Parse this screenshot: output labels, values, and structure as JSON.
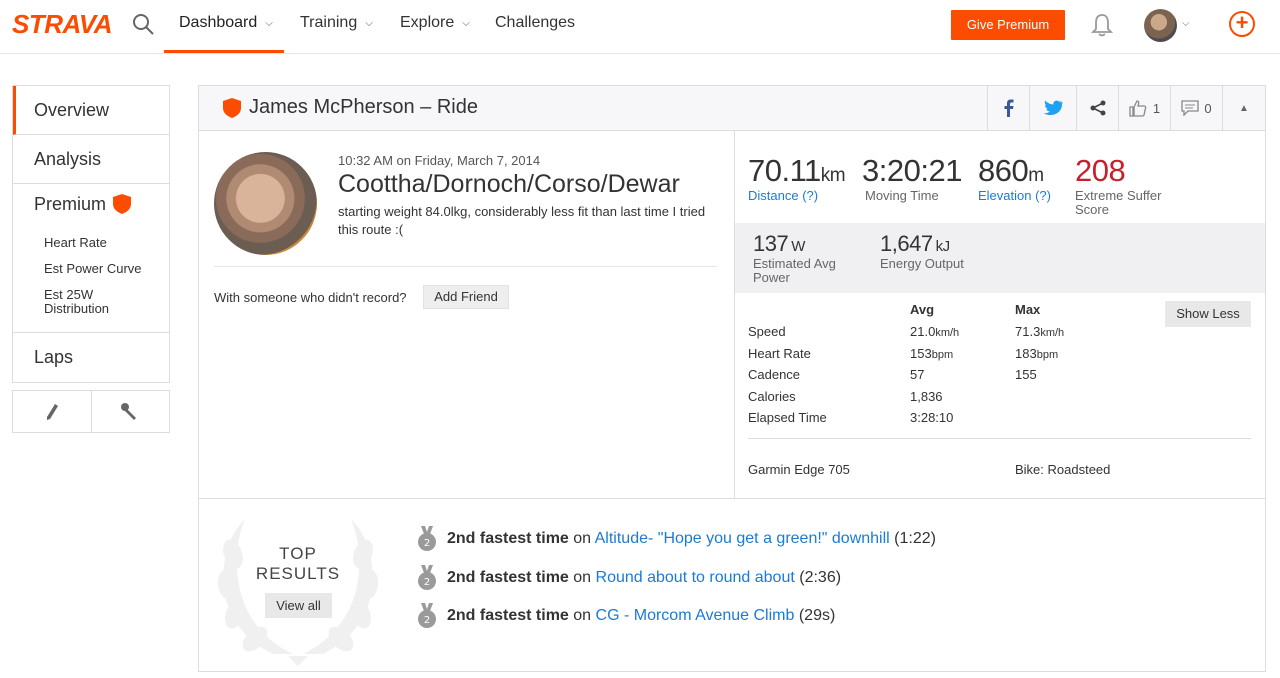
{
  "nav": {
    "logo": "STRAVA",
    "items": [
      {
        "label": "Dashboard"
      },
      {
        "label": "Training"
      },
      {
        "label": "Explore"
      },
      {
        "label": "Challenges"
      }
    ],
    "give_premium": "Give Premium",
    "icons": [
      "search-icon",
      "bell-icon",
      "avatar",
      "plus-icon"
    ],
    "accent_color": "#fc4c02"
  },
  "sidebar": {
    "items": [
      {
        "label": "Overview"
      },
      {
        "label": "Analysis"
      }
    ],
    "premium": {
      "label": "Premium",
      "sub_items": [
        {
          "label": "Heart Rate"
        },
        {
          "label": "Est Power Curve"
        },
        {
          "label": "Est 25W Distribution"
        }
      ]
    },
    "laps": "Laps",
    "tools": [
      "edit-icon",
      "wrench-icon"
    ]
  },
  "activity": {
    "title": "James McPherson – Ride",
    "kudos_count": "1",
    "comment_count": "0",
    "time": "10:32 AM on Friday, March 7, 2014",
    "name": "Coottha/Dornoch/Corso/Dewar",
    "description": "starting weight 84.0lkg, considerably less fit than last time I tried this route :(",
    "with_someone": "With someone who didn't record?",
    "add_friend": "Add Friend"
  },
  "stats": {
    "distance": {
      "value": "70.11",
      "unit": "km",
      "label": "Distance (?)"
    },
    "moving_time": {
      "value": "3:20:21",
      "label": "Moving Time"
    },
    "elevation": {
      "value": "860",
      "unit": "m",
      "label": "Elevation (?)"
    },
    "suffer": {
      "value": "208",
      "label1": "Extreme Suffer",
      "label2": "Score"
    },
    "power": {
      "value": "137",
      "unit": "W",
      "label1": "Estimated Avg",
      "label2": "Power"
    },
    "energy": {
      "value": "1,647",
      "unit": "kJ",
      "label": "Energy Output"
    },
    "table": {
      "avg_header": "Avg",
      "max_header": "Max",
      "show_less": "Show Less",
      "rows": [
        {
          "label": "Speed",
          "avg": "21.0",
          "avg_unit": "km/h",
          "max": "71.3",
          "max_unit": "km/h"
        },
        {
          "label": "Heart Rate",
          "avg": "153",
          "avg_unit": "bpm",
          "max": "183",
          "max_unit": "bpm"
        },
        {
          "label": "Cadence",
          "avg": "57",
          "avg_unit": "",
          "max": "155",
          "max_unit": ""
        },
        {
          "label": "Calories",
          "avg": "1,836",
          "avg_unit": "",
          "max": "",
          "max_unit": ""
        },
        {
          "label": "Elapsed Time",
          "avg": "3:28:10",
          "avg_unit": "",
          "max": "",
          "max_unit": ""
        }
      ]
    },
    "device": "Garmin Edge 705",
    "bike": "Bike: Roadsteed",
    "suffer_color": "#c81f2d",
    "link_color": "#1a7bd8"
  },
  "results": {
    "heading": "TOP RESULTS",
    "view_all": "View all",
    "items": [
      {
        "medal": "2",
        "rank_text": "2nd fastest time",
        "on": "on",
        "segment": "Altitude- \"Hope you get a green!\" downhill",
        "time": "(1:22)"
      },
      {
        "medal": "2",
        "rank_text": "2nd fastest time",
        "on": "on",
        "segment": "Round about to round about",
        "time": "(2:36)"
      },
      {
        "medal": "2",
        "rank_text": "2nd fastest time",
        "on": "on",
        "segment": "CG - Morcom Avenue Climb",
        "time": "(29s)"
      }
    ]
  }
}
